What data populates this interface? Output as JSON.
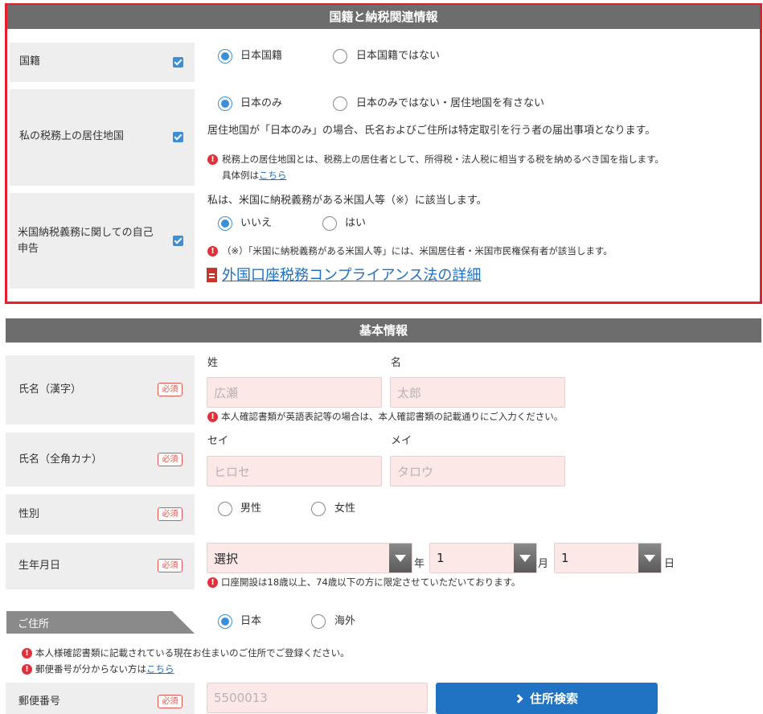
{
  "tax_section": {
    "title": "国籍と納税関連情報",
    "nationality": {
      "label": "国籍",
      "options": [
        "日本国籍",
        "日本国籍ではない"
      ],
      "selected": 0
    },
    "residence": {
      "label": "私の税務上の居住地国",
      "options": [
        "日本のみ",
        "日本のみではない・居住地国を有さない"
      ],
      "selected": 0,
      "info": "居住地国が「日本のみ」の場合、氏名およびご住所は特定取引を行う者の届出事項となります。",
      "note_line1": "税務上の居住地国とは、税務上の居住者として、所得税・法人税に相当する税を納めるべき国を指します。",
      "note_line2_prefix": "具体例は",
      "note_link": "こちら"
    },
    "us_tax": {
      "label_line1": "米国納税義務に関しての自己",
      "label_line2": "申告",
      "statement": "私は、米国に納税義務がある米国人等（※）に該当します。",
      "options": [
        "いいえ",
        "はい"
      ],
      "selected": 0,
      "note": "（※）「米国に納税義務がある米国人等」には、米国居住者・米国市民権保有者が該当します。",
      "pdf_link": "外国口座税務コンプライアンス法の詳細"
    }
  },
  "basic_section": {
    "title": "基本情報",
    "required_badge": "必須",
    "name_kanji": {
      "label": "氏名（漢字）",
      "last_caption": "姓",
      "first_caption": "名",
      "last_placeholder": "広瀬",
      "first_placeholder": "太郎",
      "note": "本人確認書類が英語表記等の場合は、本人確認書類の記載通りにご入力ください。"
    },
    "name_kana": {
      "label": "氏名（全角カナ）",
      "last_caption": "セイ",
      "first_caption": "メイ",
      "last_placeholder": "ヒロセ",
      "first_placeholder": "タロウ"
    },
    "gender": {
      "label": "性別",
      "options": [
        "男性",
        "女性"
      ]
    },
    "birthdate": {
      "label": "生年月日",
      "year_value": "選択",
      "year_unit": "年",
      "month_value": "1",
      "month_unit": "月",
      "day_value": "1",
      "day_unit": "日",
      "note": "口座開設は18歳以上、74歳以下の方に限定させていただいております。"
    },
    "address": {
      "label": "ご住所",
      "options": [
        "日本",
        "海外"
      ],
      "selected": 0,
      "note1": "本人様確認書類に記載されている現在お住まいのご住所でご登録ください。",
      "note2_prefix": "郵便番号が分からない方は",
      "note2_link": "こちら"
    },
    "postal": {
      "label": "郵便番号",
      "placeholder": "5500013",
      "search_button": "住所検索"
    }
  },
  "colors": {
    "frame_red": "#e3202b",
    "header_gray": "#6d6d6d",
    "accent_blue": "#3a8fd8",
    "button_blue": "#1f73c2",
    "input_pink": "#fde8e8",
    "warn_red": "#e2303a"
  }
}
